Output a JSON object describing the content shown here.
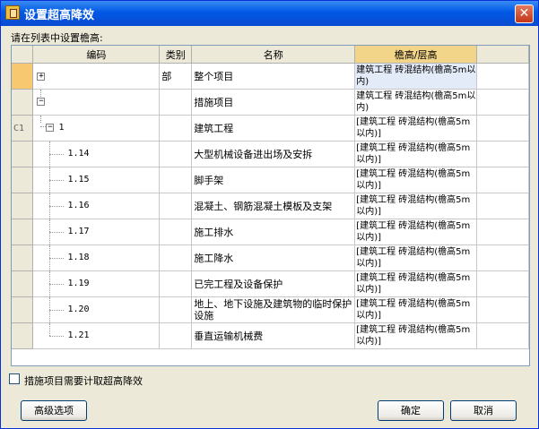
{
  "window": {
    "title": "设置超高降效"
  },
  "prompt": "请在列表中设置檐高:",
  "table": {
    "headers": [
      "编码",
      "类别",
      "名称",
      "檐高/层高"
    ],
    "rows": [
      {
        "row_header": "",
        "expander": "+",
        "code": "",
        "type": "部",
        "name": "整个项目",
        "height": "建筑工程 砖混结构(檐高5m以内)"
      },
      {
        "row_header": "",
        "expander": "−",
        "code": "",
        "type": "",
        "name": "措施项目",
        "height": "建筑工程 砖混结构(檐高5m以内)"
      },
      {
        "row_header": "C1",
        "expander": "−",
        "code": "1",
        "type": "",
        "name": "建筑工程",
        "height": "[建筑工程 砖混结构(檐高5m以内)]"
      },
      {
        "row_header": "",
        "expander": "",
        "code": "1.14",
        "type": "",
        "name": "大型机械设备进出场及安拆",
        "height": "[建筑工程 砖混结构(檐高5m以内)]"
      },
      {
        "row_header": "",
        "expander": "",
        "code": "1.15",
        "type": "",
        "name": "脚手架",
        "height": "[建筑工程 砖混结构(檐高5m以内)]"
      },
      {
        "row_header": "",
        "expander": "",
        "code": "1.16",
        "type": "",
        "name": "混凝土、钢筋混凝土模板及支架",
        "height": "[建筑工程 砖混结构(檐高5m以内)]"
      },
      {
        "row_header": "",
        "expander": "",
        "code": "1.17",
        "type": "",
        "name": "施工排水",
        "height": "[建筑工程 砖混结构(檐高5m以内)]"
      },
      {
        "row_header": "",
        "expander": "",
        "code": "1.18",
        "type": "",
        "name": "施工降水",
        "height": "[建筑工程 砖混结构(檐高5m以内)]"
      },
      {
        "row_header": "",
        "expander": "",
        "code": "1.19",
        "type": "",
        "name": "已完工程及设备保护",
        "height": "[建筑工程 砖混结构(檐高5m以内)]"
      },
      {
        "row_header": "",
        "expander": "",
        "code": "1.20",
        "type": "",
        "name": "地上、地下设施及建筑物的临时保护设施",
        "height": "[建筑工程 砖混结构(檐高5m以内)]"
      },
      {
        "row_header": "",
        "expander": "",
        "code": "1.21",
        "type": "",
        "name": "垂直运输机械费",
        "height": "[建筑工程 砖混结构(檐高5m以内)]"
      }
    ]
  },
  "checkbox": {
    "label": "措施项目需要计取超高降效",
    "checked": false
  },
  "buttons": {
    "advanced": "高级选项",
    "ok": "确定",
    "cancel": "取消"
  }
}
